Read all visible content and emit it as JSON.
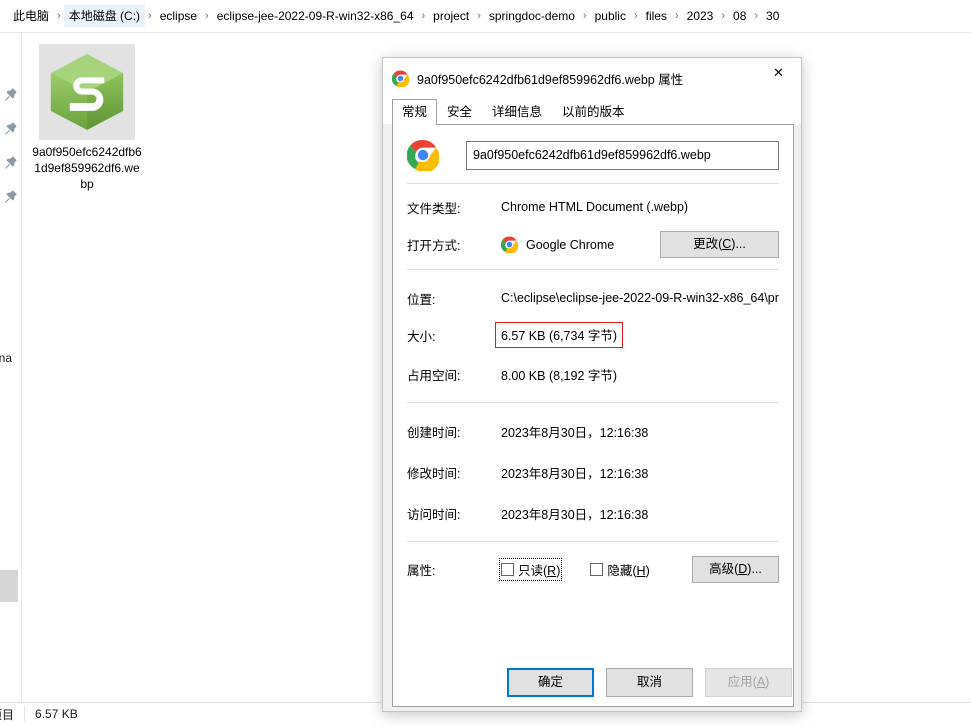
{
  "explorer": {
    "breadcrumb": {
      "name": "address-breadcrumb",
      "items": [
        {
          "label": "此电脑",
          "highlight": false
        },
        {
          "label": "本地磁盘 (C:)",
          "highlight": true
        },
        {
          "label": "eclipse",
          "highlight": false
        },
        {
          "label": "eclipse-jee-2022-09-R-win32-x86_64",
          "highlight": false
        },
        {
          "label": "project",
          "highlight": false
        },
        {
          "label": "springdoc-demo",
          "highlight": false
        },
        {
          "label": "public",
          "highlight": false
        },
        {
          "label": "files",
          "highlight": false
        },
        {
          "label": "2023",
          "highlight": false
        },
        {
          "label": "08",
          "highlight": false
        },
        {
          "label": "30",
          "highlight": false
        }
      ],
      "separator": "›"
    },
    "nav_pane": {
      "pin_icon_name": "pin-icon",
      "pin_count": 4,
      "partial_text": "ona"
    },
    "file_item": {
      "thumbnail_icon": "green-hex-s-logo-thumbnail",
      "label": "9a0f950efc6242dfb61d9ef859962df6.webp"
    },
    "status_bar": {
      "count_text": "项目",
      "size_text": "6.57 KB"
    }
  },
  "dialog": {
    "title": "9a0f950efc6242dfb61d9ef859962df6.webp 属性",
    "title_icon": "chrome-icon",
    "close_label": "✕",
    "tabs": [
      {
        "label": "常规",
        "active": true
      },
      {
        "label": "安全",
        "active": false
      },
      {
        "label": "详细信息",
        "active": false
      },
      {
        "label": "以前的版本",
        "active": false
      }
    ],
    "file_icon": "chrome-icon",
    "filename_value": "9a0f950efc6242dfb61d9ef859962df6.webp",
    "rows": {
      "filetype_label": "文件类型:",
      "filetype_value": "Chrome HTML Document (.webp)",
      "openwith_label": "打开方式:",
      "openwith_app": "Google Chrome",
      "change_button": "更改(C)...",
      "location_label": "位置:",
      "location_value": "C:\\eclipse\\eclipse-jee-2022-09-R-win32-x86_64\\pr",
      "size_label": "大小:",
      "size_value": "6.57 KB (6,734 字节)",
      "ondisk_label": "占用空间:",
      "ondisk_value": "8.00 KB (8,192 字节)",
      "created_label": "创建时间:",
      "created_value": "2023年8月30日，12:16:38",
      "modified_label": "修改时间:",
      "modified_value": "2023年8月30日，12:16:38",
      "accessed_label": "访问时间:",
      "accessed_value": "2023年8月30日，12:16:38",
      "attributes_label": "属性:",
      "readonly_label": "只读(R)",
      "hidden_label": "隐藏(H)",
      "advanced_button": "高级(D)..."
    },
    "footer": {
      "ok": "确定",
      "cancel": "取消",
      "apply": "应用(A)"
    },
    "highlight_color": "#e01b1b",
    "accent_color": "#0078d7"
  }
}
